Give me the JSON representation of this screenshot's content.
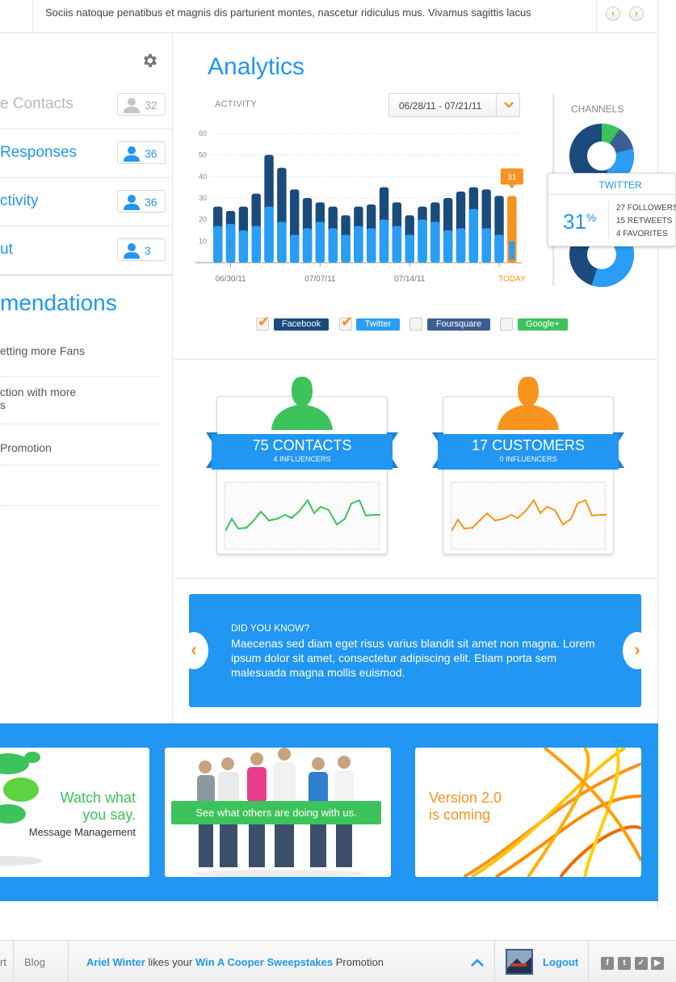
{
  "ticker": {
    "text": "Sociis natoque penatibus et magnis dis parturient montes, nascetur ridiculus mus. Vivamus sagittis lacus",
    "prev_glyph": "‹",
    "next_glyph": "›"
  },
  "sidebar": {
    "items": [
      {
        "label": "e Contacts",
        "count": "32"
      },
      {
        "label": "Responses",
        "count": "36"
      },
      {
        "label": "ctivity",
        "count": "36"
      },
      {
        "label": "ut",
        "count": "3"
      }
    ],
    "recs_title": "mendations",
    "recs": [
      "etting more Fans",
      "ction with more",
      "s",
      "Promotion"
    ]
  },
  "analytics": {
    "title": "Analytics",
    "activity_label": "ACTIVITY",
    "date_range": "06/28/11 - 07/21/11",
    "channels_label": "CHANNELS",
    "twitter_popup": {
      "title": "TWITTER",
      "percent": "31",
      "percent_sign": "%",
      "stats": [
        "27 FOLLOWERS",
        "15 RETWEETS",
        "4 FAVORITES"
      ]
    },
    "legend": [
      {
        "label": "Facebook",
        "checked": true,
        "color": "#1a4b7c"
      },
      {
        "label": "Twitter",
        "checked": true,
        "color": "#2a9df4"
      },
      {
        "label": "Foursquare",
        "checked": false,
        "color": "#3b5f93"
      },
      {
        "label": "Google+",
        "checked": false,
        "color": "#3cc35b"
      }
    ]
  },
  "chart_data": {
    "type": "bar",
    "ylim": [
      0,
      60
    ],
    "yticks": [
      "10",
      "20",
      "30",
      "40",
      "50",
      "60"
    ],
    "xlabels": [
      "06/30/11",
      "07/07/11",
      "07/14/11",
      "TODAY"
    ],
    "highlight_label": "31",
    "series": [
      {
        "name": "Facebook",
        "values": [
          26,
          24,
          26,
          32,
          50,
          44,
          34,
          30,
          28,
          26,
          22,
          26,
          27,
          35,
          28,
          22,
          26,
          28,
          30,
          33,
          35,
          34,
          31,
          26
        ]
      },
      {
        "name": "Twitter",
        "values": [
          17,
          18,
          15,
          17,
          26,
          19,
          13,
          16,
          19,
          16,
          13,
          17,
          16,
          20,
          17,
          13,
          20,
          19,
          15,
          16,
          25,
          16,
          13,
          31
        ]
      }
    ],
    "colors": {
      "facebook": "#1a4b7c",
      "twitter": "#2a9df4",
      "highlight": "#f7941d"
    }
  },
  "cards": [
    {
      "big": "75 CONTACTS",
      "small": "4 INFLUENCERS",
      "color": "#3cc35b"
    },
    {
      "big": "17 CUSTOMERS",
      "small": "0 INFLUENCERS",
      "color": "#f7941d"
    }
  ],
  "dyk": {
    "heading": "DID YOU KNOW?",
    "body": "Maecenas sed diam eget risus varius blandit sit amet non magna. Lorem ipsum dolor sit amet, consectetur adipiscing elit. Etiam porta sem malesuada magna mollis euismod.",
    "prev": "‹",
    "next": "›"
  },
  "promos": {
    "watch_line1": "Watch what",
    "watch_line2": "you say.",
    "watch_sub": "Message Management",
    "see": "See what others are doing with us.",
    "v2_line1": "Version 2.0",
    "v2_line2": "is coming"
  },
  "footer": {
    "rt": "rt",
    "blog": "Blog",
    "notif_user": "Ariel Winter",
    "notif_mid": " likes your ",
    "notif_item": "Win A Cooper Sweepstakes",
    "notif_end": " Promotion",
    "logout": "Logout"
  }
}
